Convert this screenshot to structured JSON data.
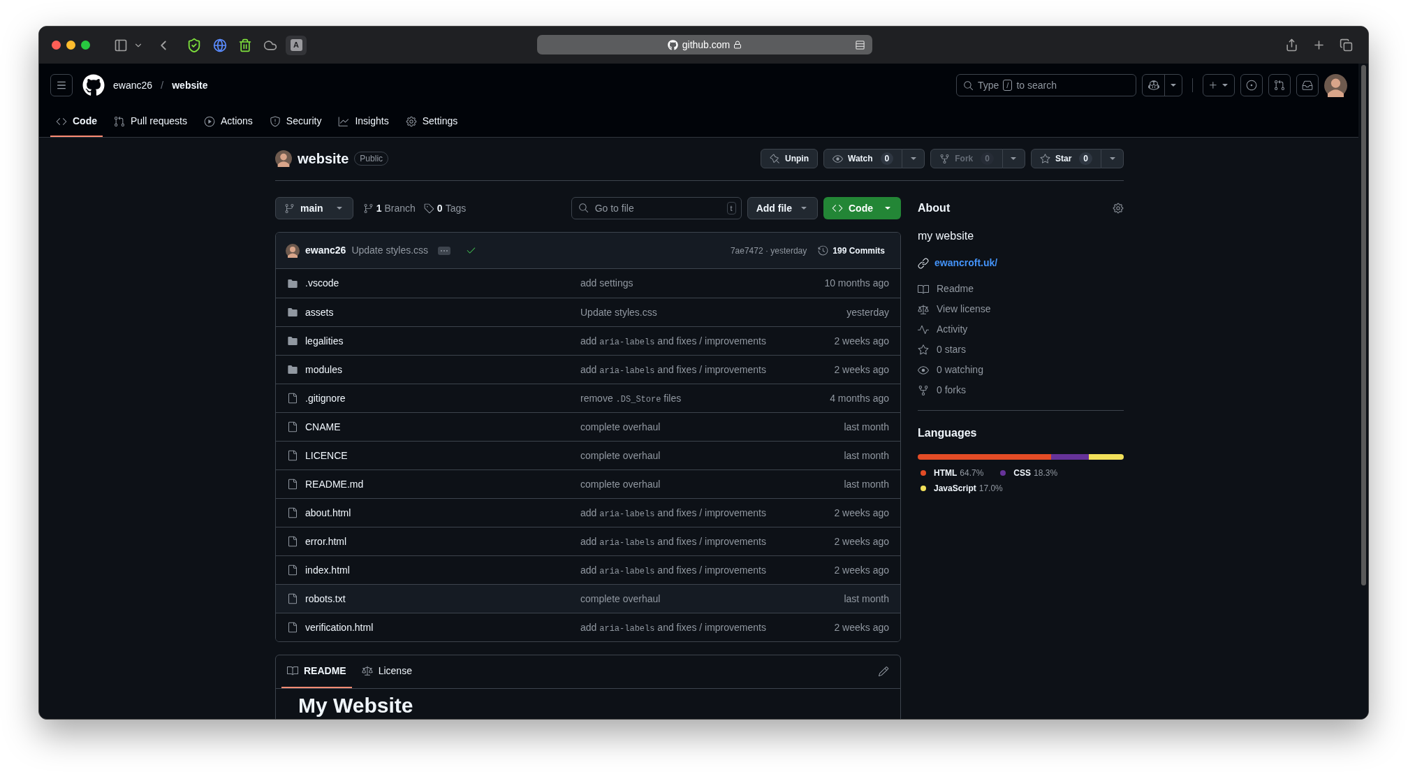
{
  "browser": {
    "url": "github.com",
    "extension_letter": "A"
  },
  "header": {
    "owner": "ewanc26",
    "separator": "/",
    "repo": "website",
    "search": {
      "before": "Type",
      "key": "/",
      "after": "to search"
    }
  },
  "nav_tabs": [
    {
      "kind": "code",
      "label": "Code",
      "selected": true
    },
    {
      "kind": "pull",
      "label": "Pull requests",
      "selected": false
    },
    {
      "kind": "actions",
      "label": "Actions",
      "selected": false
    },
    {
      "kind": "security",
      "label": "Security",
      "selected": false
    },
    {
      "kind": "insights",
      "label": "Insights",
      "selected": false
    },
    {
      "kind": "settings",
      "label": "Settings",
      "selected": false
    }
  ],
  "repo": {
    "name": "website",
    "visibility": "Public"
  },
  "repo_actions": [
    {
      "kind": "pin",
      "label": "Unpin",
      "disabled": false
    },
    {
      "kind": "watch",
      "label": "Watch",
      "count": "0",
      "disabled": false
    },
    {
      "kind": "fork",
      "label": "Fork",
      "count": "0",
      "disabled": true
    },
    {
      "kind": "star",
      "label": "Star",
      "count": "0",
      "disabled": false
    }
  ],
  "toolbar": {
    "branch": "main",
    "branch_count": "1",
    "branch_label": "Branch",
    "tag_count": "0",
    "tag_label": "Tags",
    "go_to_file": {
      "placeholder": "Go to file",
      "key": "t"
    },
    "add_file": "Add file",
    "code": "Code"
  },
  "latest_commit": {
    "author": "ewanc26",
    "message": "Update styles.css",
    "sha_time": "7ae7472 · yesterday",
    "commits": "199 Commits"
  },
  "files": [
    {
      "kind": "folder",
      "name": ".vscode",
      "message": [
        {
          "kind": "text",
          "text": "add settings"
        }
      ],
      "time": "10 months ago",
      "hovered": false
    },
    {
      "kind": "folder",
      "name": "assets",
      "message": [
        {
          "kind": "text",
          "text": "Update styles.css"
        }
      ],
      "time": "yesterday",
      "hovered": false
    },
    {
      "kind": "folder",
      "name": "legalities",
      "message": [
        {
          "kind": "text",
          "text": "add"
        },
        {
          "kind": "code",
          "text": "aria-labels"
        },
        {
          "kind": "text",
          "text": "and fixes / improvements"
        }
      ],
      "time": "2 weeks ago",
      "hovered": false
    },
    {
      "kind": "folder",
      "name": "modules",
      "message": [
        {
          "kind": "text",
          "text": "add"
        },
        {
          "kind": "code",
          "text": "aria-labels"
        },
        {
          "kind": "text",
          "text": "and fixes / improvements"
        }
      ],
      "time": "2 weeks ago",
      "hovered": false
    },
    {
      "kind": "file",
      "name": ".gitignore",
      "message": [
        {
          "kind": "text",
          "text": "remove"
        },
        {
          "kind": "code",
          "text": ".DS_Store"
        },
        {
          "kind": "text",
          "text": "files"
        }
      ],
      "time": "4 months ago",
      "hovered": false
    },
    {
      "kind": "file",
      "name": "CNAME",
      "message": [
        {
          "kind": "text",
          "text": "complete overhaul"
        }
      ],
      "time": "last month",
      "hovered": false
    },
    {
      "kind": "file",
      "name": "LICENCE",
      "message": [
        {
          "kind": "text",
          "text": "complete overhaul"
        }
      ],
      "time": "last month",
      "hovered": false
    },
    {
      "kind": "file",
      "name": "README.md",
      "message": [
        {
          "kind": "text",
          "text": "complete overhaul"
        }
      ],
      "time": "last month",
      "hovered": false
    },
    {
      "kind": "file",
      "name": "about.html",
      "message": [
        {
          "kind": "text",
          "text": "add"
        },
        {
          "kind": "code",
          "text": "aria-labels"
        },
        {
          "kind": "text",
          "text": "and fixes / improvements"
        }
      ],
      "time": "2 weeks ago",
      "hovered": false
    },
    {
      "kind": "file",
      "name": "error.html",
      "message": [
        {
          "kind": "text",
          "text": "add"
        },
        {
          "kind": "code",
          "text": "aria-labels"
        },
        {
          "kind": "text",
          "text": "and fixes / improvements"
        }
      ],
      "time": "2 weeks ago",
      "hovered": false
    },
    {
      "kind": "file",
      "name": "index.html",
      "message": [
        {
          "kind": "text",
          "text": "add"
        },
        {
          "kind": "code",
          "text": "aria-labels"
        },
        {
          "kind": "text",
          "text": "and fixes / improvements"
        }
      ],
      "time": "2 weeks ago",
      "hovered": false
    },
    {
      "kind": "file",
      "name": "robots.txt",
      "message": [
        {
          "kind": "text",
          "text": "complete overhaul"
        }
      ],
      "time": "last month",
      "hovered": true
    },
    {
      "kind": "file",
      "name": "verification.html",
      "message": [
        {
          "kind": "text",
          "text": "add"
        },
        {
          "kind": "code",
          "text": "aria-labels"
        },
        {
          "kind": "text",
          "text": "and fixes / improvements"
        }
      ],
      "time": "2 weeks ago",
      "hovered": false
    }
  ],
  "about": {
    "title": "About",
    "description": "my website",
    "link": "ewancroft.uk/",
    "items": [
      {
        "kind": "readme",
        "label": "Readme"
      },
      {
        "kind": "license",
        "label": "View license"
      },
      {
        "kind": "activity",
        "label": "Activity"
      },
      {
        "kind": "stars",
        "label": "0 stars"
      },
      {
        "kind": "watching",
        "label": "0 watching"
      },
      {
        "kind": "forks",
        "label": "0 forks"
      }
    ]
  },
  "languages": {
    "title": "Languages",
    "items": [
      {
        "name": "HTML",
        "percent": "64.7%",
        "color": "#e34c26"
      },
      {
        "name": "CSS",
        "percent": "18.3%",
        "color": "#663399"
      },
      {
        "name": "JavaScript",
        "percent": "17.0%",
        "color": "#f1e05a"
      }
    ]
  },
  "readme": {
    "tabs": [
      {
        "kind": "book",
        "label": "README",
        "selected": true
      },
      {
        "kind": "law",
        "label": "License",
        "selected": false
      }
    ],
    "heading": "My Website"
  }
}
